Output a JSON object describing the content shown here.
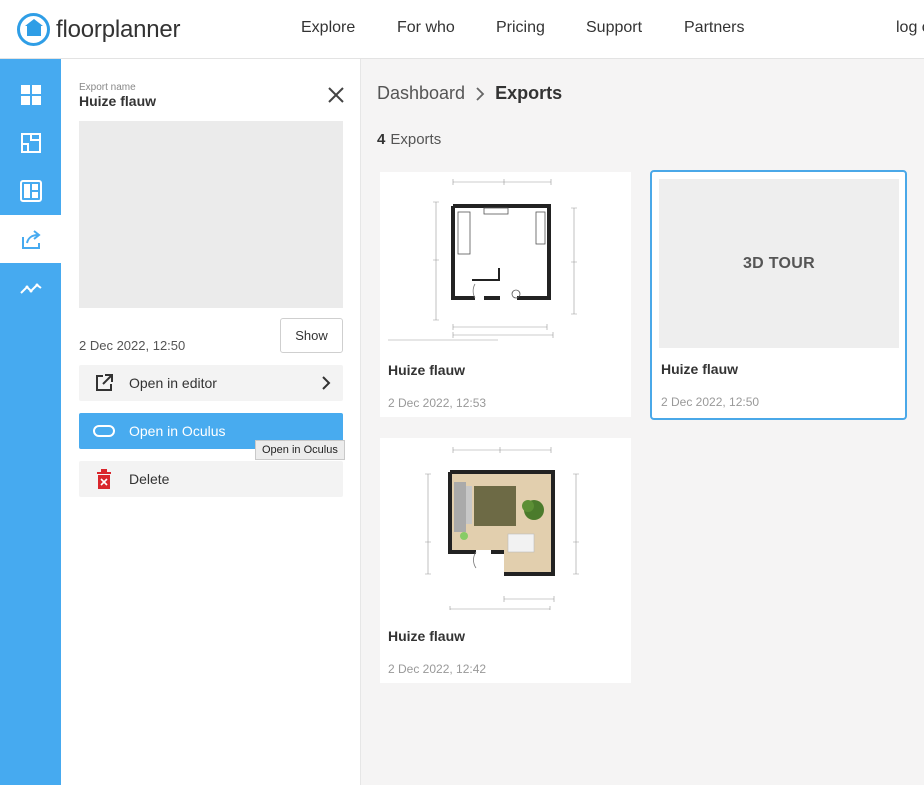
{
  "brand": {
    "name": "floorplanner",
    "color": "#2f9ee6"
  },
  "nav": {
    "items": [
      "Explore",
      "For who",
      "Pricing",
      "Support",
      "Partners"
    ],
    "login": "log o"
  },
  "rail": {
    "items": [
      {
        "icon": "dashboard-icon",
        "active": false
      },
      {
        "icon": "floorplan-icon",
        "active": false
      },
      {
        "icon": "layout-icon",
        "active": false
      },
      {
        "icon": "exports-icon",
        "active": true
      },
      {
        "icon": "analytics-icon",
        "active": false
      }
    ],
    "color": "#46aaf0"
  },
  "panel": {
    "label": "Export name",
    "name": "Huize flauw",
    "date": "2 Dec 2022, 12:50",
    "show_label": "Show",
    "actions": [
      {
        "label": "Open in editor",
        "icon": "external-link-icon"
      },
      {
        "label": "Open in Oculus",
        "icon": "oculus-icon"
      },
      {
        "label": "Delete",
        "icon": "trash-icon"
      }
    ],
    "tooltip": "Open in Oculus"
  },
  "breadcrumb": {
    "parent": "Dashboard",
    "current": "Exports"
  },
  "exports": {
    "count": "4",
    "count_label": "Exports",
    "cards": [
      {
        "title": "Huize flauw",
        "date": "2 Dec 2022, 12:53",
        "kind": "plan-2d-lines"
      },
      {
        "title": "Huize flauw",
        "date": "2 Dec 2022, 12:50",
        "kind": "3d-tour",
        "tour_label": "3D TOUR"
      },
      {
        "title": "Huize flauw",
        "date": "2 Dec 2022, 12:42",
        "kind": "plan-2d-color"
      }
    ]
  }
}
